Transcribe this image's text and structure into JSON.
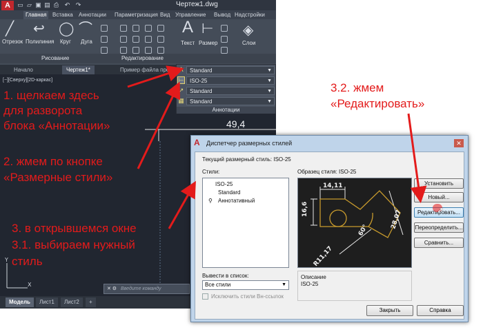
{
  "window": {
    "title": "Чертеж1.dwg",
    "logo": "A",
    "qat_icons": [
      "new-file-icon",
      "open-icon",
      "save-icon",
      "save-as-icon",
      "print-icon",
      "undo-icon",
      "redo-icon"
    ]
  },
  "ribbon_tabs": [
    {
      "label": "Главная",
      "active": true
    },
    {
      "label": "Вставка"
    },
    {
      "label": "Аннотации"
    },
    {
      "label": "Параметризация"
    },
    {
      "label": "Вид"
    },
    {
      "label": "Управление"
    },
    {
      "label": "Вывод"
    },
    {
      "label": "Надстройки"
    }
  ],
  "ribbon": {
    "draw_tools": [
      "Отрезок",
      "Полилиния",
      "Круг",
      "Дуга"
    ],
    "annotation_tools": [
      "Текст",
      "Размер"
    ],
    "layers_label": "Слои",
    "panels": {
      "draw": "Рисование",
      "edit": "Редактирование"
    }
  },
  "annotation_panel": {
    "rows": [
      "Standard",
      "ISO-25",
      "Standard",
      "Standard"
    ],
    "footer": "Аннотации"
  },
  "doc_tabs": [
    "Начало",
    "Чертеж1*",
    "Пример файла прое"
  ],
  "viewport_label": "[−][Сверху][2D-каркас]",
  "dimension_value": "49,4",
  "layout_tabs": [
    "Модель",
    "Лист1",
    "Лист2",
    "+"
  ],
  "command_placeholder": "Введите команду",
  "dialog": {
    "title": "Диспетчер размерных стилей",
    "current_style_label": "Текущий размерный стиль: ISO-25",
    "styles_label": "Стили:",
    "styles": [
      "ISO-25",
      "Standard",
      "Аннотативный"
    ],
    "preview_label": "Образец стиля: ISO-25",
    "preview_values": [
      "14,11",
      "16,6",
      "28,07",
      "60°",
      "R11,17"
    ],
    "buttons": [
      "Установить",
      "Новый...",
      "Редактировать...",
      "Переопределить...",
      "Сравнить..."
    ],
    "list_label": "Вывести в список:",
    "list_value": "Все стили",
    "exclude_xref": "Исключить стили Вн-ссылок",
    "description_label": "Описание",
    "description": "ISO-25",
    "close_btn": "Закрыть",
    "help_btn": "Справка"
  },
  "notes": [
    "1. щелкаем здесь",
    "для разворота",
    "блока «Аннотации»",
    "2. жмем по кнопке",
    "«Размерные стили»",
    "3. в открывшемся окне",
    "3.1. выбираем нужный",
    "стиль",
    "3.2. жмем",
    "«Редактировать»"
  ],
  "colors": {
    "annotation_red": "#e31b1b",
    "cad_background": "#212630",
    "dialog_frame": "#bfd4ea"
  }
}
